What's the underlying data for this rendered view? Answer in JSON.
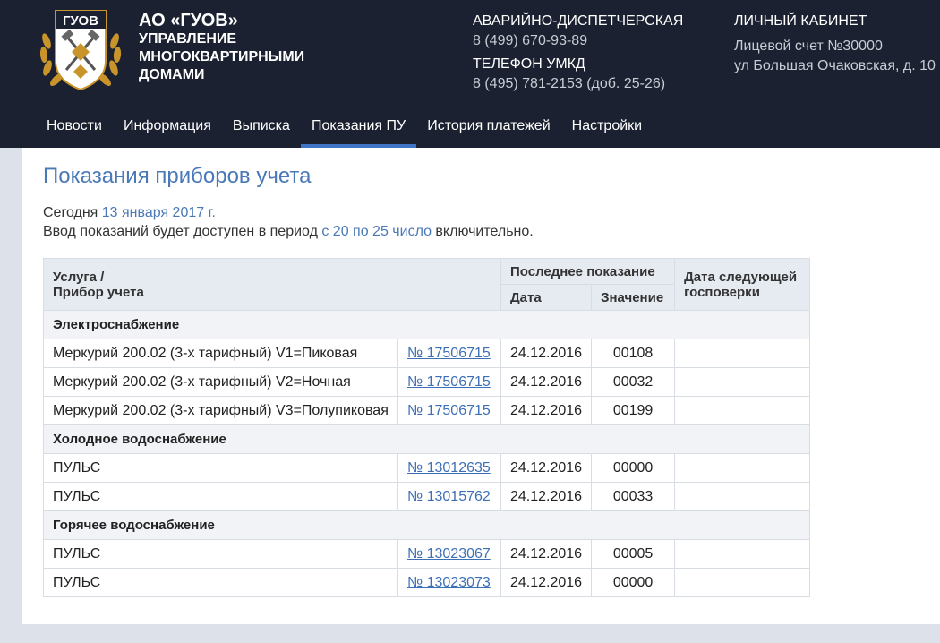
{
  "header": {
    "logo_text": "ГУОВ",
    "org_name": "АО «ГУОВ»",
    "org_sub": [
      "УПРАВЛЕНИЕ",
      "МНОГОКВАРТИРНЫМИ",
      "ДОМАМИ"
    ],
    "emergency_label": "АВАРИЙНО-ДИСПЕТЧЕРСКАЯ",
    "emergency_phone": "8 (499) 670-93-89",
    "umkd_label": "ТЕЛЕФОН УМКД",
    "umkd_phone": "8 (495) 781-2153 (доб. 25-26)",
    "cabinet_title": "ЛИЧНЫЙ КАБИНЕТ",
    "account": "Лицевой счет №30000",
    "address": "ул Большая Очаковская, д. 10"
  },
  "nav": {
    "items": [
      {
        "label": "Новости"
      },
      {
        "label": "Информация"
      },
      {
        "label": "Выписка"
      },
      {
        "label": "Показания ПУ"
      },
      {
        "label": "История платежей"
      },
      {
        "label": "Настройки"
      }
    ],
    "active_index": 3
  },
  "main": {
    "title": "Показания приборов учета",
    "today_prefix": "Сегодня ",
    "today_date": "13 января 2017 г.",
    "period_prefix": "Ввод показаний будет доступен в период ",
    "period_range": "с 20 по 25 число",
    "period_suffix": " включительно."
  },
  "table": {
    "head_service": [
      "Услуга /",
      "Прибор учета"
    ],
    "head_last": "Последнее показание",
    "head_date": "Дата",
    "head_value": "Значение",
    "head_next": [
      "Дата следующей",
      "госповерки"
    ],
    "groups": [
      {
        "name": "Электроснабжение",
        "rows": [
          {
            "device": "Меркурий 200.02 (3-х тарифный) V1=Пиковая",
            "number": "№ 17506715",
            "date": "24.12.2016",
            "value": "00108",
            "next": ""
          },
          {
            "device": "Меркурий 200.02 (3-х тарифный) V2=Ночная",
            "number": "№ 17506715",
            "date": "24.12.2016",
            "value": "00032",
            "next": ""
          },
          {
            "device": "Меркурий 200.02 (3-х тарифный) V3=Полупиковая",
            "number": "№ 17506715",
            "date": "24.12.2016",
            "value": "00199",
            "next": ""
          }
        ]
      },
      {
        "name": "Холодное водоснабжение",
        "rows": [
          {
            "device": "ПУЛЬС",
            "number": "№ 13012635",
            "date": "24.12.2016",
            "value": "00000",
            "next": ""
          },
          {
            "device": "ПУЛЬС",
            "number": "№ 13015762",
            "date": "24.12.2016",
            "value": "00033",
            "next": ""
          }
        ]
      },
      {
        "name": "Горячее водоснабжение",
        "rows": [
          {
            "device": "ПУЛЬС",
            "number": "№ 13023067",
            "date": "24.12.2016",
            "value": "00005",
            "next": ""
          },
          {
            "device": "ПУЛЬС",
            "number": "№ 13023073",
            "date": "24.12.2016",
            "value": "00000",
            "next": ""
          }
        ]
      }
    ]
  },
  "colors": {
    "header_bg": "#1b2130",
    "accent": "#3d74c6",
    "link": "#3d6fb6",
    "logo_gold": "#c9952a"
  }
}
